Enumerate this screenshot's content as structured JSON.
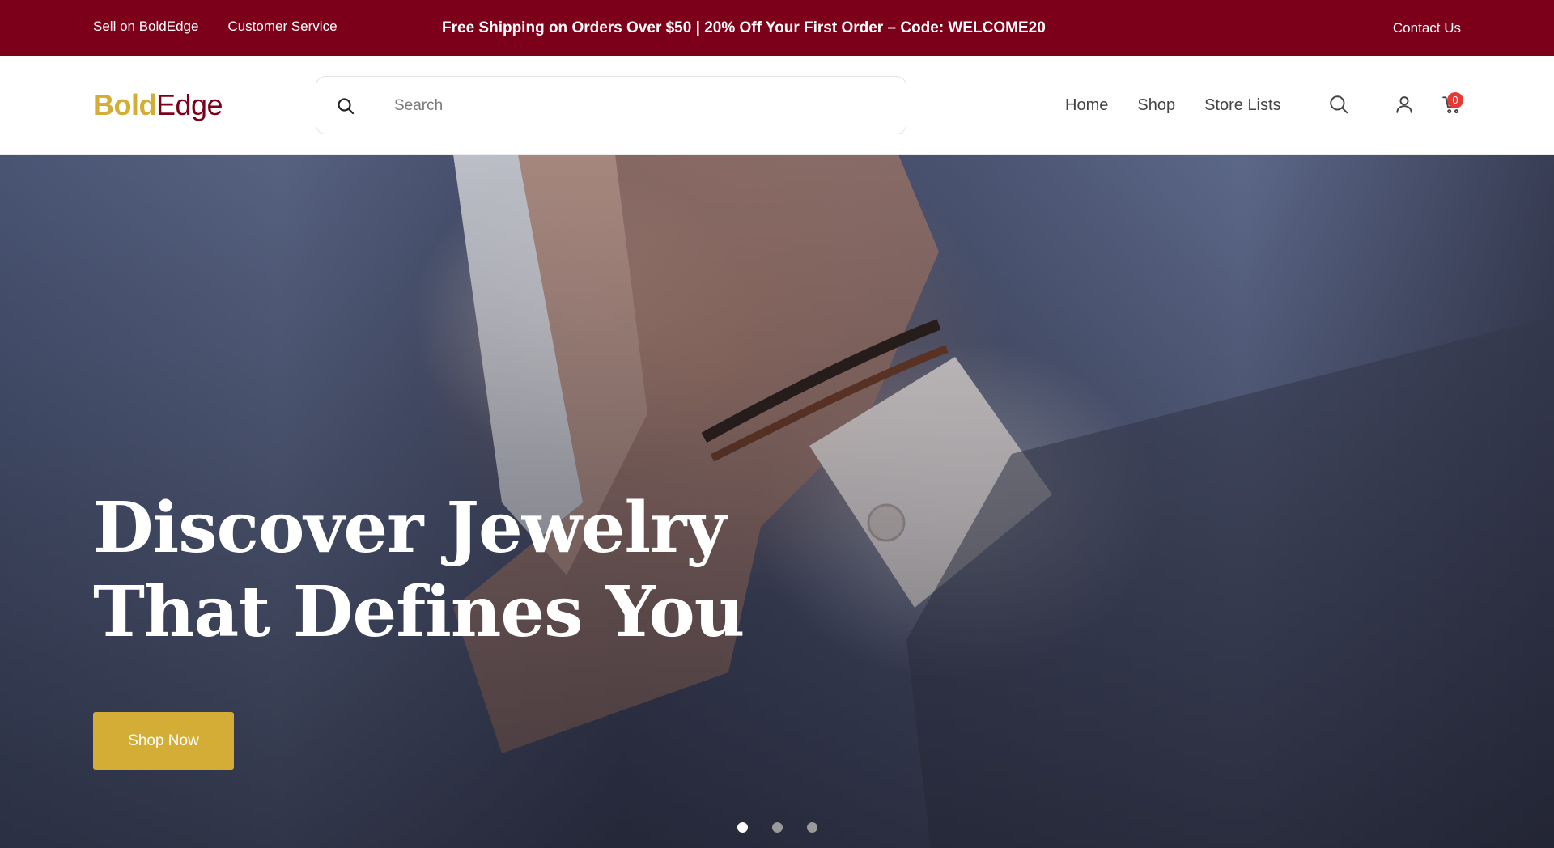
{
  "topbar": {
    "sell_label": "Sell on BoldEdge",
    "service_label": "Customer Service",
    "promo_text": "Free Shipping on Orders Over $50 | 20% Off Your First Order – Code: WELCOME20",
    "contact_label": "Contact Us"
  },
  "header": {
    "logo_bold": "Bold",
    "logo_edge": "Edge",
    "search_placeholder": "Search",
    "search_value": "",
    "nav": [
      "Home",
      "Shop",
      "Store Lists"
    ],
    "cart_count": "0"
  },
  "hero": {
    "title_line1": "Discover Jewelry",
    "title_line2": "That Defines You",
    "cta_label": "Shop Now",
    "slides_total": 3,
    "active_slide": 1
  },
  "colors": {
    "brand_red": "#7c0019",
    "brand_gold": "#d3ad36",
    "badge_red": "#e53935"
  },
  "icons": [
    "search-icon",
    "user-icon",
    "cart-icon"
  ]
}
